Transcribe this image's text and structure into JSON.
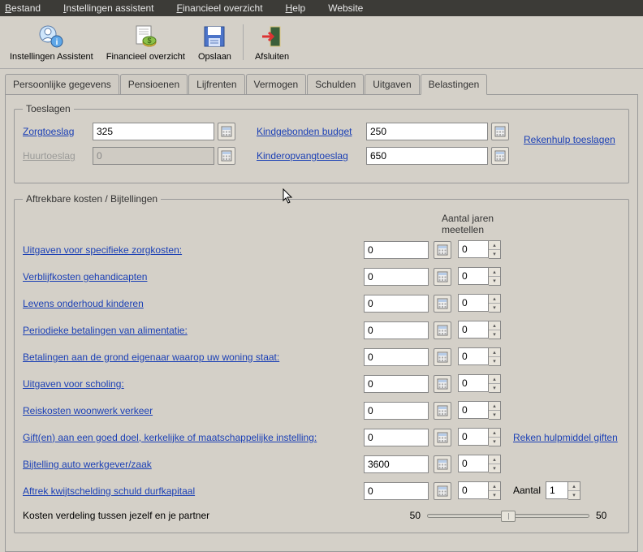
{
  "menubar": {
    "bestand": "Bestand",
    "instellingen": "Instellingen assistent",
    "financieel": "Financieel overzicht",
    "help": "Help",
    "website": "Website"
  },
  "toolbar": {
    "instellingen": "Instellingen Assistent",
    "financieel": "Financieel overzicht",
    "opslaan": "Opslaan",
    "afsluiten": "Afsluiten"
  },
  "tabs": {
    "persoonlijke": "Persoonlijke gegevens",
    "pensioenen": "Pensioenen",
    "lijfrenten": "Lijfrenten",
    "vermogen": "Vermogen",
    "schulden": "Schulden",
    "uitgaven": "Uitgaven",
    "belastingen": "Belastingen"
  },
  "toeslagen": {
    "legend": "Toeslagen",
    "zorgtoeslag_label": "Zorgtoeslag",
    "zorgtoeslag_value": "325",
    "huurtoeslag_label": "Huurtoeslag",
    "huurtoeslag_value": "0",
    "kindgebonden_label": "Kindgebonden budget",
    "kindgebonden_value": "250",
    "kinderopvang_label": "Kinderopvangtoeslag",
    "kinderopvang_value": "650",
    "rekenhulp": "Rekenhulp toeslagen"
  },
  "aftrek": {
    "legend": "Aftrekbare kosten / Bijtellingen",
    "col_header": "Aantal jaren meetellen",
    "rows": [
      {
        "label": "Uitgaven voor specifieke zorgkosten:",
        "value": "0",
        "years": "0"
      },
      {
        "label": "Verblijfkosten gehandicapten",
        "value": "0",
        "years": "0"
      },
      {
        "label": "Levens onderhoud kinderen",
        "value": "0",
        "years": "0"
      },
      {
        "label": "Periodieke betalingen van alimentatie: ",
        "value": "0",
        "years": "0"
      },
      {
        "label": "Betalingen aan de grond eigenaar waarop uw woning staat:",
        "value": "0",
        "years": "0"
      },
      {
        "label": "Uitgaven voor scholing:",
        "value": "0",
        "years": "0"
      },
      {
        "label": "Reiskosten woonwerk verkeer",
        "value": "0",
        "years": "0"
      },
      {
        "label": "Gift(en) aan een goed doel, kerkelijke of maatschappelijke instelling:",
        "value": "0",
        "years": "0"
      },
      {
        "label": "Bijtelling auto werkgever/zaak",
        "value": "3600",
        "years": "0"
      },
      {
        "label": "Aftrek kwijtschelding schuld durfkapitaal",
        "value": "0",
        "years": "0"
      }
    ],
    "giften_link": "Reken hulpmiddel giften",
    "aantal_label": "Aantal",
    "aantal_value": "1",
    "verdeling_label": "Kosten verdeling tussen jezelf en je partner",
    "verdeling_left": "50",
    "verdeling_right": "50"
  }
}
